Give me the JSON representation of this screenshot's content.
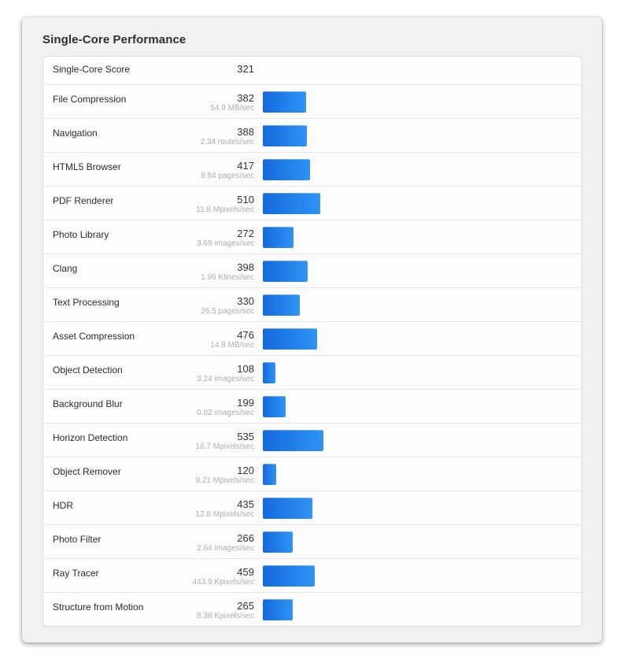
{
  "panel": {
    "title": "Single-Core Performance"
  },
  "colors": {
    "bar_start": "#1569dd",
    "bar_end": "#2e94f5",
    "panel_background": "#f1f1f1",
    "list_background": "#fdfdfd",
    "row_divider": "#e6e6e6",
    "label_text": "#2b2b2b",
    "score_text": "#333333",
    "unit_text": "#adadad"
  },
  "summary": {
    "label": "Single-Core Score",
    "score": "321"
  },
  "chart_data": {
    "type": "bar",
    "title": "Single-Core Performance",
    "xlabel": "",
    "ylabel": "",
    "orientation": "horizontal",
    "categories": [
      "File Compression",
      "Navigation",
      "HTML5 Browser",
      "PDF Renderer",
      "Photo Library",
      "Clang",
      "Text Processing",
      "Asset Compression",
      "Object Detection",
      "Background Blur",
      "Horizon Detection",
      "Object Remover",
      "HDR",
      "Photo Filter",
      "Ray Tracer",
      "Structure from Motion"
    ],
    "values": [
      382,
      388,
      417,
      510,
      272,
      398,
      330,
      476,
      108,
      199,
      535,
      120,
      435,
      266,
      459,
      265
    ],
    "xlim": [
      0,
      560
    ],
    "grid": false,
    "legend": null,
    "annotations": [
      "54.9 MB/sec",
      "2.34 routes/sec",
      "8.54 pages/sec",
      "11.8 Mpixels/sec",
      "3.69 images/sec",
      "1.96 Klines/sec",
      "26.5 pages/sec",
      "14.8 MB/sec",
      "3.24 images/sec",
      "0.82 images/sec",
      "16.7 Mpixels/sec",
      "9.21 Mpixels/sec",
      "12.8 Mpixels/sec",
      "2.64 images/sec",
      "443.9 Kpixels/sec",
      "8.38 Kpixels/sec"
    ]
  },
  "rows": [
    {
      "label": "File Compression",
      "score": "382",
      "unit": "54.9 MB/sec",
      "value": 382
    },
    {
      "label": "Navigation",
      "score": "388",
      "unit": "2.34 routes/sec",
      "value": 388
    },
    {
      "label": "HTML5 Browser",
      "score": "417",
      "unit": "8.54 pages/sec",
      "value": 417
    },
    {
      "label": "PDF Renderer",
      "score": "510",
      "unit": "11.8 Mpixels/sec",
      "value": 510
    },
    {
      "label": "Photo Library",
      "score": "272",
      "unit": "3.69 images/sec",
      "value": 272
    },
    {
      "label": "Clang",
      "score": "398",
      "unit": "1.96 Klines/sec",
      "value": 398
    },
    {
      "label": "Text Processing",
      "score": "330",
      "unit": "26.5 pages/sec",
      "value": 330
    },
    {
      "label": "Asset Compression",
      "score": "476",
      "unit": "14.8 MB/sec",
      "value": 476
    },
    {
      "label": "Object Detection",
      "score": "108",
      "unit": "3.24 images/sec",
      "value": 108
    },
    {
      "label": "Background Blur",
      "score": "199",
      "unit": "0.82 images/sec",
      "value": 199
    },
    {
      "label": "Horizon Detection",
      "score": "535",
      "unit": "16.7 Mpixels/sec",
      "value": 535
    },
    {
      "label": "Object Remover",
      "score": "120",
      "unit": "9.21 Mpixels/sec",
      "value": 120
    },
    {
      "label": "HDR",
      "score": "435",
      "unit": "12.8 Mpixels/sec",
      "value": 435
    },
    {
      "label": "Photo Filter",
      "score": "266",
      "unit": "2.64 images/sec",
      "value": 266
    },
    {
      "label": "Ray Tracer",
      "score": "459",
      "unit": "443.9 Kpixels/sec",
      "value": 459
    },
    {
      "label": "Structure from Motion",
      "score": "265",
      "unit": "8.38 Kpixels/sec",
      "value": 265
    }
  ]
}
